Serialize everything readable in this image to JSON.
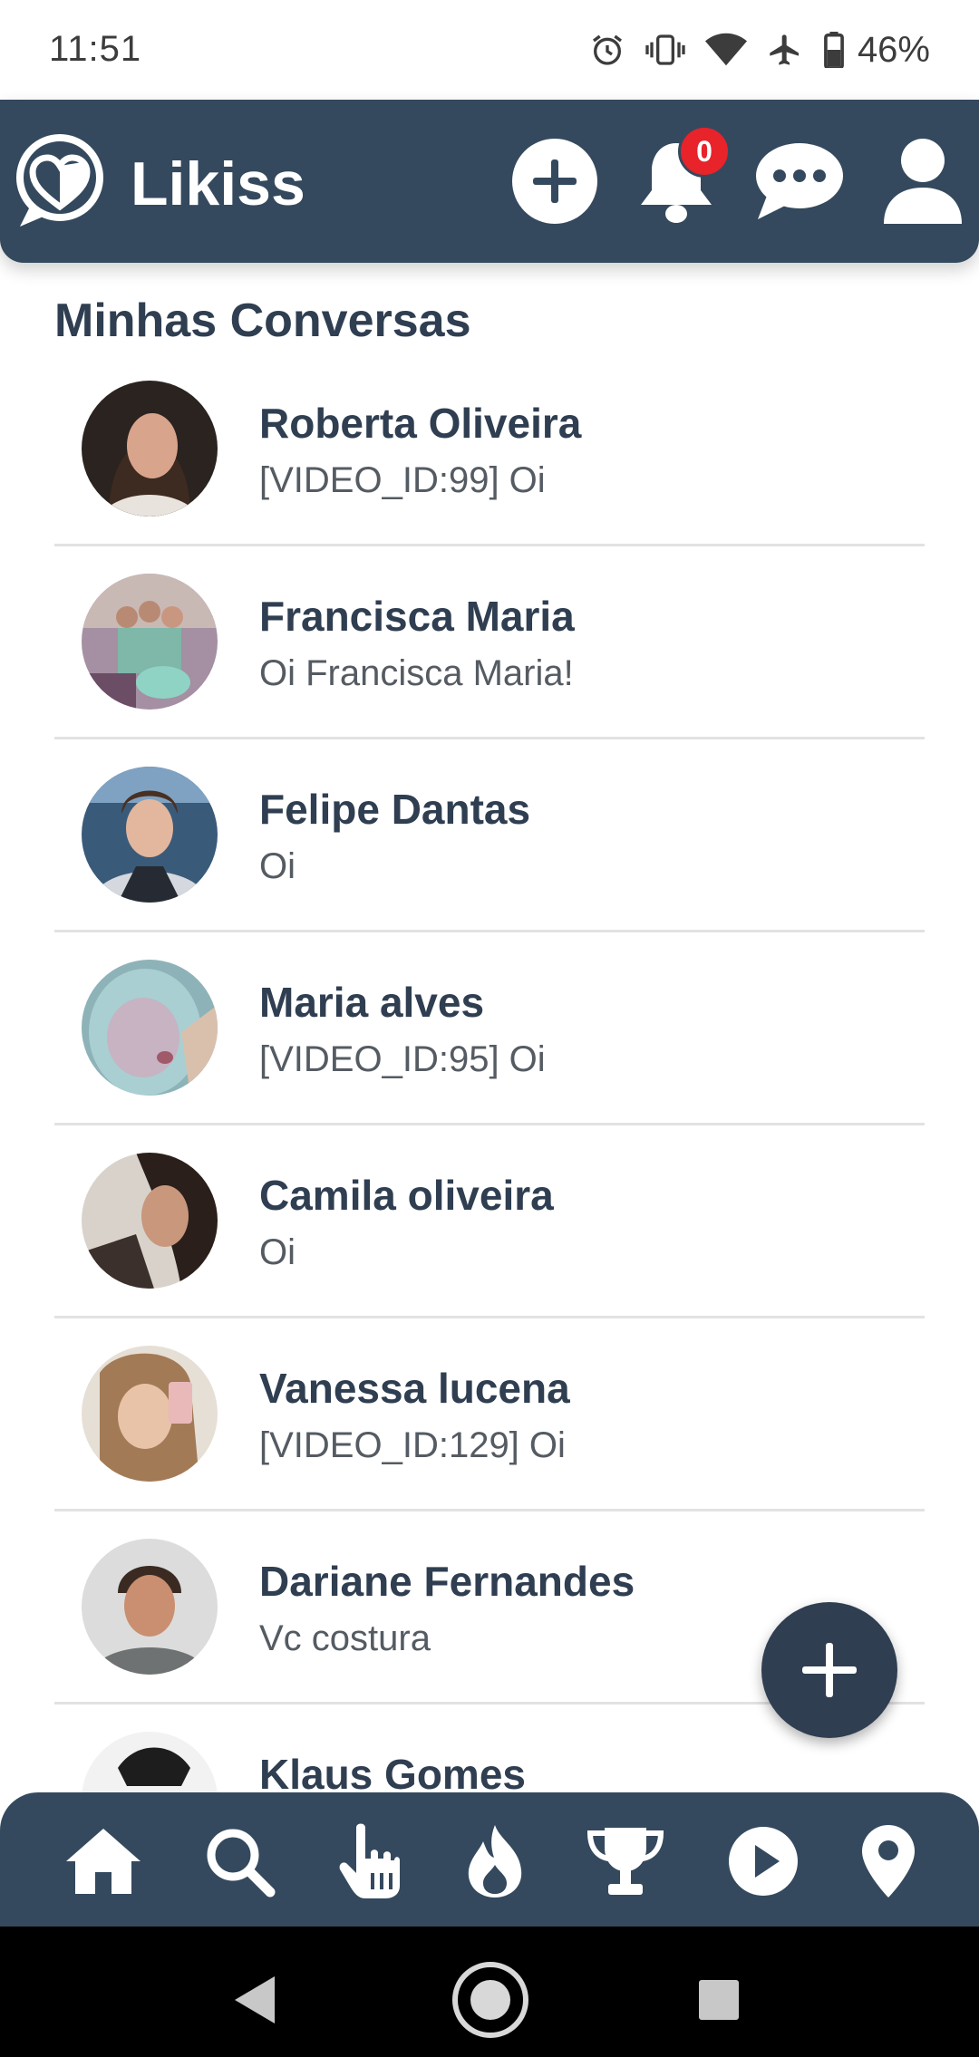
{
  "status_bar": {
    "time": "11:51",
    "battery_percent": "46%",
    "icons": [
      "alarm-icon",
      "vibrate-icon",
      "wifi-icon",
      "airplane-icon",
      "battery-icon"
    ]
  },
  "header": {
    "title": "Likiss",
    "notification_count": "0",
    "colors": {
      "bar": "#34495e",
      "badge": "#e8232a"
    }
  },
  "main": {
    "section_title": "Minhas Conversas",
    "conversations": [
      {
        "name": "Roberta Oliveira",
        "preview": "[VIDEO_ID:99] Oi"
      },
      {
        "name": "Francisca Maria",
        "preview": "Oi Francisca Maria!"
      },
      {
        "name": "Felipe Dantas",
        "preview": "Oi"
      },
      {
        "name": "Maria alves",
        "preview": "[VIDEO_ID:95] Oi"
      },
      {
        "name": "Camila oliveira",
        "preview": "Oi"
      },
      {
        "name": "Vanessa lucena",
        "preview": "[VIDEO_ID:129] Oi"
      },
      {
        "name": "Dariane Fernandes",
        "preview": "Vc costura"
      },
      {
        "name": "Klaus Gomes",
        "preview": ""
      }
    ]
  },
  "bottom_nav": {
    "items": [
      "home-icon",
      "search-icon",
      "tap-icon",
      "fire-icon",
      "trophy-icon",
      "play-icon",
      "location-icon"
    ]
  },
  "system_nav": {
    "items": [
      "back-icon",
      "home-circle-icon",
      "recents-icon"
    ]
  }
}
